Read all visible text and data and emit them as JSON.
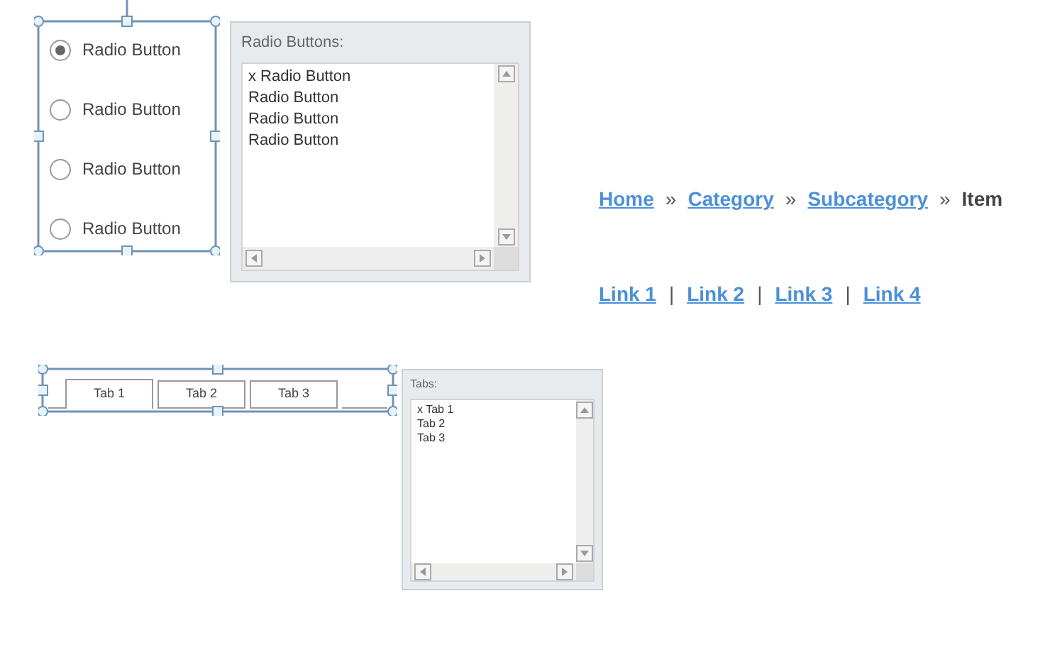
{
  "radio_group": {
    "items": [
      {
        "label": "Radio Button",
        "selected": true
      },
      {
        "label": "Radio Button",
        "selected": false
      },
      {
        "label": "Radio Button",
        "selected": false
      },
      {
        "label": "Radio Button",
        "selected": false
      }
    ]
  },
  "radio_editor": {
    "title": "Radio Buttons:",
    "lines": [
      "x Radio Button",
      "Radio Button",
      "Radio Button",
      "Radio Button"
    ]
  },
  "breadcrumb": [
    {
      "kind": "link",
      "text": "Home"
    },
    {
      "kind": "separator",
      "text": "»"
    },
    {
      "kind": "link",
      "text": "Category"
    },
    {
      "kind": "separator",
      "text": "»"
    },
    {
      "kind": "link",
      "text": "Subcategory"
    },
    {
      "kind": "separator",
      "text": "»"
    },
    {
      "kind": "current",
      "text": "Item"
    }
  ],
  "link_bar": [
    {
      "kind": "link",
      "text": "Link 1"
    },
    {
      "kind": "separator",
      "text": "|"
    },
    {
      "kind": "link",
      "text": "Link 2"
    },
    {
      "kind": "separator",
      "text": "|"
    },
    {
      "kind": "link",
      "text": "Link 3"
    },
    {
      "kind": "separator",
      "text": "|"
    },
    {
      "kind": "link",
      "text": "Link 4"
    }
  ],
  "tabs": [
    {
      "label": "Tab 1",
      "selected": true
    },
    {
      "label": "Tab 2",
      "selected": false
    },
    {
      "label": "Tab 3",
      "selected": false
    }
  ],
  "tabs_editor": {
    "title": "Tabs:",
    "lines": [
      "x Tab 1",
      "Tab 2",
      "Tab 3"
    ]
  }
}
